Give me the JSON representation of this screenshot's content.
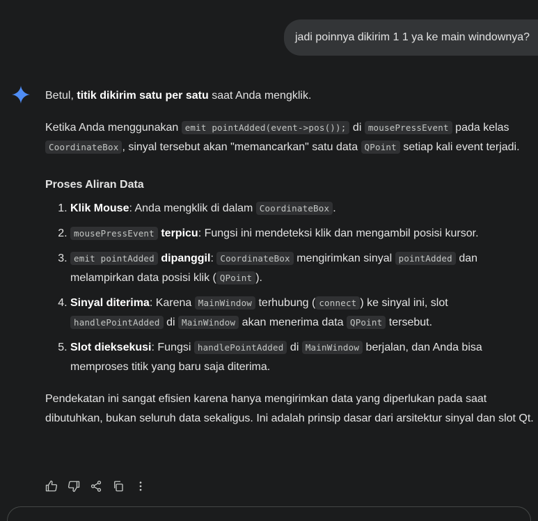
{
  "user_message": "jadi poinnya dikirim 1 1 ya ke main windownya?",
  "answer": {
    "p1": {
      "a": "Betul, ",
      "b": "titik dikirim satu per satu",
      "c": " saat Anda mengklik."
    },
    "p2": {
      "a": "Ketika Anda menggunakan ",
      "code1": "emit pointAdded(event->pos());",
      "b": " di ",
      "code2": "mousePressEvent",
      "c": " pada kelas ",
      "code3": "CoordinateBox",
      "d": ", sinyal tersebut akan \"memancarkan\" satu data ",
      "code4": "QPoint",
      "e": " setiap kali event terjadi."
    },
    "heading": "Proses Aliran Data",
    "steps": [
      {
        "bold": "Klik Mouse",
        "t1": ": Anda mengklik di dalam ",
        "c1": "CoordinateBox",
        "t2": "."
      },
      {
        "c1": "mousePressEvent",
        "bold": "terpicu",
        "t1": ": Fungsi ini mendeteksi klik dan mengambil posisi kursor."
      },
      {
        "c1": "emit pointAdded",
        "bold": "dipanggil",
        "t1": ": ",
        "c2": "CoordinateBox",
        "t2": " mengirimkan sinyal ",
        "c3": "pointAdded",
        "t3": " dan melampirkan data posisi klik (",
        "c4": "QPoint",
        "t4": ")."
      },
      {
        "bold": "Sinyal diterima",
        "t1": ": Karena ",
        "c1": "MainWindow",
        "t2": " terhubung (",
        "c2": "connect",
        "t3": ") ke sinyal ini, slot ",
        "c3": "handlePointAdded",
        "t4": " di ",
        "c4": "MainWindow",
        "t5": " akan menerima data ",
        "c5": "QPoint",
        "t6": " tersebut."
      },
      {
        "bold": "Slot dieksekusi",
        "t1": ": Fungsi ",
        "c1": "handlePointAdded",
        "t2": " di ",
        "c2": "MainWindow",
        "t3": " berjalan, dan Anda bisa memproses titik yang baru saja diterima."
      }
    ],
    "closing": "Pendekatan ini sangat efisien karena hanya mengirimkan data yang diperlukan pada saat dibutuhkan, bukan seluruh data sekaligus. Ini adalah prinsip dasar dari arsitektur sinyal dan slot Qt."
  },
  "actions": [
    "thumb-up-icon",
    "thumb-down-icon",
    "share-icon",
    "copy-icon",
    "more-vert-icon"
  ],
  "colors": {
    "background": "#1b1c1d",
    "bubble": "#333537",
    "spark_blue": "#4f8df5",
    "code_bg": "#303133"
  }
}
